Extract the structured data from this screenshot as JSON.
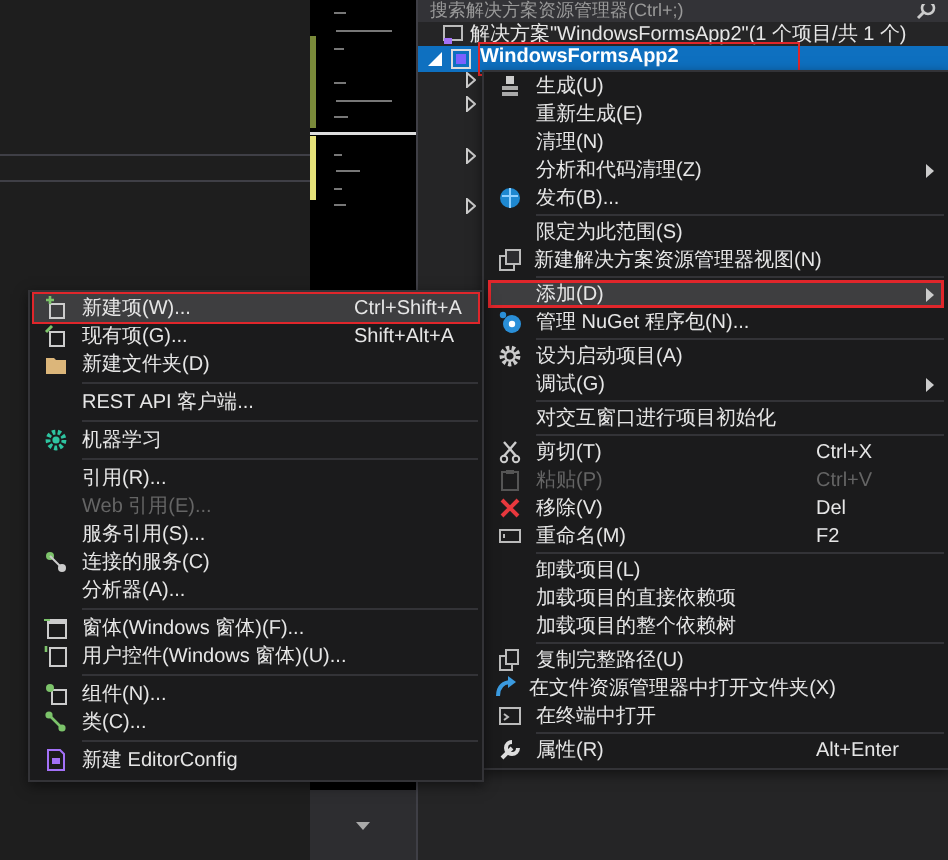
{
  "explorer": {
    "search": {
      "placeholder": "搜索解决方案资源管理器(Ctrl+;)"
    },
    "tree": [
      {
        "label": "解决方案\"WindowsFormsApp2\"(1 个项目/共 1 个)",
        "selected": false,
        "expanded": true,
        "children": [
          {
            "label": "WindowsFormsApp2",
            "selected": true,
            "expanded": true
          }
        ]
      }
    ]
  },
  "context_menu": {
    "items": [
      {
        "kind": "item",
        "label": "生成(U)",
        "submenu": false,
        "disabled": false,
        "selected": false
      },
      {
        "kind": "item",
        "label": "重新生成(E)",
        "submenu": false,
        "disabled": false,
        "selected": false
      },
      {
        "kind": "item",
        "label": "清理(N)",
        "submenu": false,
        "disabled": false,
        "selected": false
      },
      {
        "kind": "item",
        "label": "分析和代码清理(Z)",
        "submenu": true,
        "disabled": false,
        "selected": false
      },
      {
        "kind": "item",
        "label": "发布(B)...",
        "submenu": false,
        "disabled": false,
        "selected": false
      },
      {
        "kind": "separator"
      },
      {
        "kind": "item",
        "label": "限定为此范围(S)",
        "submenu": false,
        "disabled": false,
        "selected": false
      },
      {
        "kind": "item",
        "label": "新建解决方案资源管理器视图(N)",
        "submenu": false,
        "disabled": false,
        "selected": false
      },
      {
        "kind": "separator"
      },
      {
        "kind": "item",
        "label": "添加(D)",
        "submenu": true,
        "disabled": false,
        "selected": true
      },
      {
        "kind": "item",
        "label": "管理 NuGet 程序包(N)...",
        "submenu": false,
        "disabled": false,
        "selected": false
      },
      {
        "kind": "separator"
      },
      {
        "kind": "item",
        "label": "设为启动项目(A)",
        "submenu": false,
        "disabled": false,
        "selected": false
      },
      {
        "kind": "item",
        "label": "调试(G)",
        "submenu": true,
        "disabled": false,
        "selected": false
      },
      {
        "kind": "separator"
      },
      {
        "kind": "item",
        "label": "对交互窗口进行项目初始化",
        "submenu": false,
        "disabled": false,
        "selected": false
      },
      {
        "kind": "separator"
      },
      {
        "kind": "item",
        "label": "剪切(T)",
        "shortcut": "Ctrl+X",
        "submenu": false,
        "disabled": false,
        "selected": false
      },
      {
        "kind": "item",
        "label": "粘贴(P)",
        "shortcut": "Ctrl+V",
        "submenu": false,
        "disabled": true,
        "selected": false
      },
      {
        "kind": "item",
        "label": "移除(V)",
        "shortcut": "Del",
        "submenu": false,
        "disabled": false,
        "selected": false
      },
      {
        "kind": "item",
        "label": "重命名(M)",
        "shortcut": "F2",
        "submenu": false,
        "disabled": false,
        "selected": false
      },
      {
        "kind": "separator"
      },
      {
        "kind": "item",
        "label": "卸载项目(L)",
        "submenu": false,
        "disabled": false,
        "selected": false
      },
      {
        "kind": "item",
        "label": "加载项目的直接依赖项",
        "submenu": false,
        "disabled": false,
        "selected": false
      },
      {
        "kind": "item",
        "label": "加载项目的整个依赖树",
        "submenu": false,
        "disabled": false,
        "selected": false
      },
      {
        "kind": "separator"
      },
      {
        "kind": "item",
        "label": "复制完整路径(U)",
        "submenu": false,
        "disabled": false,
        "selected": false
      },
      {
        "kind": "item",
        "label": "在文件资源管理器中打开文件夹(X)",
        "submenu": false,
        "disabled": false,
        "selected": false
      },
      {
        "kind": "item",
        "label": "在终端中打开",
        "submenu": false,
        "disabled": false,
        "selected": false
      },
      {
        "kind": "separator"
      },
      {
        "kind": "item",
        "label": "属性(R)",
        "shortcut": "Alt+Enter",
        "submenu": false,
        "disabled": false,
        "selected": false
      }
    ]
  },
  "add_submenu": {
    "items": [
      {
        "kind": "item",
        "label": "新建项(W)...",
        "shortcut": "Ctrl+Shift+A",
        "disabled": false,
        "selected": true
      },
      {
        "kind": "item",
        "label": "现有项(G)...",
        "shortcut": "Shift+Alt+A",
        "disabled": false,
        "selected": false
      },
      {
        "kind": "item",
        "label": "新建文件夹(D)",
        "disabled": false,
        "selected": false
      },
      {
        "kind": "separator"
      },
      {
        "kind": "item",
        "label": "REST API 客户端...",
        "disabled": false,
        "selected": false
      },
      {
        "kind": "separator"
      },
      {
        "kind": "item",
        "label": "机器学习",
        "disabled": false,
        "selected": false
      },
      {
        "kind": "separator"
      },
      {
        "kind": "item",
        "label": "引用(R)...",
        "disabled": false,
        "selected": false
      },
      {
        "kind": "item",
        "label": "Web 引用(E)...",
        "disabled": true,
        "selected": false
      },
      {
        "kind": "item",
        "label": "服务引用(S)...",
        "disabled": false,
        "selected": false
      },
      {
        "kind": "item",
        "label": "连接的服务(C)",
        "disabled": false,
        "selected": false
      },
      {
        "kind": "item",
        "label": "分析器(A)...",
        "disabled": false,
        "selected": false
      },
      {
        "kind": "separator"
      },
      {
        "kind": "item",
        "label": "窗体(Windows 窗体)(F)...",
        "disabled": false,
        "selected": false
      },
      {
        "kind": "item",
        "label": "用户控件(Windows 窗体)(U)...",
        "disabled": false,
        "selected": false
      },
      {
        "kind": "separator"
      },
      {
        "kind": "item",
        "label": "组件(N)...",
        "disabled": false,
        "selected": false
      },
      {
        "kind": "item",
        "label": "类(C)...",
        "disabled": false,
        "selected": false
      },
      {
        "kind": "separator"
      },
      {
        "kind": "item",
        "label": "新建 EditorConfig",
        "disabled": false,
        "selected": false
      }
    ]
  }
}
